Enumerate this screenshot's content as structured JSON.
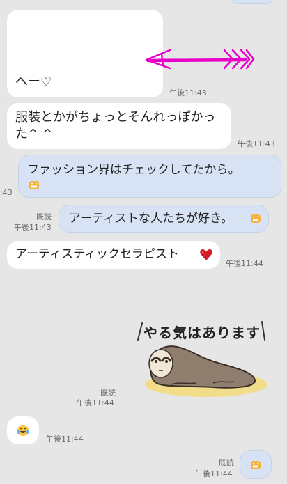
{
  "colors": {
    "background": "#e6e6e6",
    "incoming_bubble": "#ffffff",
    "outgoing_bubble": "#d7e3f5",
    "arrow": "#e600c8",
    "sticker_sloth": "#8f7d6e",
    "sticker_ground": "#f2dd8a"
  },
  "messages": [
    {
      "id": "m1",
      "side": "incoming",
      "text": "へー♡",
      "time": "午後11:43",
      "has_arrow": true
    },
    {
      "id": "m2",
      "side": "incoming",
      "text_line1": "服装とかがちょっとそんれっぽかっ",
      "text_line2": "た^ ^",
      "time": "午後11:43"
    },
    {
      "id": "m3",
      "side": "outgoing",
      "text": "ファッション界はチェックしてたから。",
      "time_partial": ":43",
      "emoji": "grin-emoji"
    },
    {
      "id": "m4",
      "side": "outgoing",
      "text": "アーティストな人たちが好き。",
      "read": "既読",
      "time": "午後11:43",
      "emoji": "grin-emoji"
    },
    {
      "id": "m5",
      "side": "incoming",
      "text": "アーティスティックセラピスト",
      "time": "午後11:44",
      "emoji": "heart-icon"
    },
    {
      "id": "m6",
      "side": "outgoing",
      "type": "sticker",
      "sticker_text": "やる気はあります",
      "read": "既読",
      "time": "午後11:44"
    },
    {
      "id": "m7",
      "side": "incoming",
      "type": "emoji",
      "emoji": "laughing-emoji",
      "time": "午後11:44"
    },
    {
      "id": "m8",
      "side": "outgoing",
      "type": "emoji",
      "emoji": "grin-emoji",
      "read": "既読",
      "time": "午後11:44"
    }
  ]
}
